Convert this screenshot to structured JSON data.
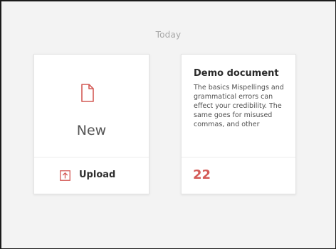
{
  "section": {
    "label": "Today"
  },
  "new_card": {
    "label": "New",
    "upload_label": "Upload",
    "icon": "new-document-icon",
    "upload_icon": "upload-icon"
  },
  "document_card": {
    "title": "Demo document",
    "preview": "The basics Mispellings and grammatical errors can effect your credibility. The same goes for misused commas, and other",
    "count": "22"
  },
  "colors": {
    "accent": "#d45b57",
    "background": "#f3f3f3",
    "card": "#ffffff"
  }
}
